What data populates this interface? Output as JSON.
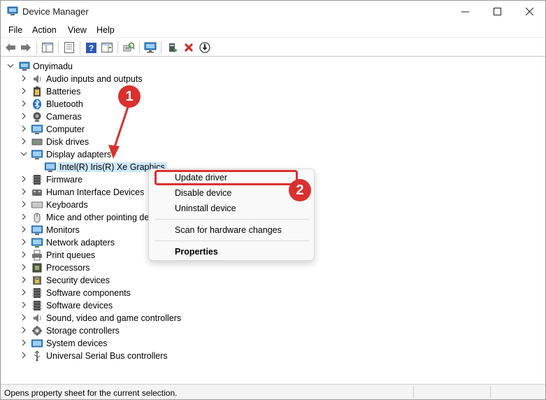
{
  "window": {
    "title": "Device Manager",
    "controls": {
      "minimize": "—",
      "maximize": "☐",
      "close": "✕"
    }
  },
  "menu": [
    "File",
    "Action",
    "View",
    "Help"
  ],
  "toolbar": {
    "icons": [
      "back-arrow-icon",
      "forward-arrow-icon",
      "show-hide-tree-icon",
      "properties-icon",
      "help-icon",
      "action-pane-icon",
      "scan-hardware-icon",
      "monitor-icon",
      "enable-device-icon",
      "uninstall-icon",
      "update-driver-icon"
    ]
  },
  "tree": {
    "root": "Onyimadu",
    "categories": [
      {
        "label": "Audio inputs and outputs",
        "icon": "speaker-icon",
        "expanded": false
      },
      {
        "label": "Batteries",
        "icon": "battery-icon",
        "expanded": false
      },
      {
        "label": "Bluetooth",
        "icon": "bluetooth-icon",
        "expanded": false
      },
      {
        "label": "Cameras",
        "icon": "camera-icon",
        "expanded": false
      },
      {
        "label": "Computer",
        "icon": "computer-icon",
        "expanded": false
      },
      {
        "label": "Disk drives",
        "icon": "disk-icon",
        "expanded": false
      },
      {
        "label": "Display adapters",
        "icon": "display-adapter-icon",
        "expanded": true
      },
      {
        "label": "Intel(R) Iris(R) Xe Graphics",
        "icon": "display-adapter-icon",
        "child": true,
        "selected": true
      },
      {
        "label": "Firmware",
        "icon": "firmware-icon",
        "expanded": false
      },
      {
        "label": "Human Interface Devices",
        "icon": "hid-icon",
        "expanded": false
      },
      {
        "label": "Keyboards",
        "icon": "keyboard-icon",
        "expanded": false
      },
      {
        "label": "Mice and other pointing de",
        "icon": "mouse-icon",
        "expanded": false
      },
      {
        "label": "Monitors",
        "icon": "monitor-icon",
        "expanded": false
      },
      {
        "label": "Network adapters",
        "icon": "network-icon",
        "expanded": false
      },
      {
        "label": "Print queues",
        "icon": "printer-icon",
        "expanded": false
      },
      {
        "label": "Processors",
        "icon": "processor-icon",
        "expanded": false
      },
      {
        "label": "Security devices",
        "icon": "security-icon",
        "expanded": false
      },
      {
        "label": "Software components",
        "icon": "software-component-icon",
        "expanded": false
      },
      {
        "label": "Software devices",
        "icon": "software-device-icon",
        "expanded": false
      },
      {
        "label": "Sound, video and game controllers",
        "icon": "sound-icon",
        "expanded": false
      },
      {
        "label": "Storage controllers",
        "icon": "storage-icon",
        "expanded": false
      },
      {
        "label": "System devices",
        "icon": "system-icon",
        "expanded": false
      },
      {
        "label": "Universal Serial Bus controllers",
        "icon": "usb-icon",
        "expanded": false
      }
    ]
  },
  "context_menu": {
    "update": "Update driver",
    "disable": "Disable device",
    "uninstall": "Uninstall device",
    "scan": "Scan for hardware changes",
    "properties": "Properties"
  },
  "annotations": {
    "step1": "1",
    "step2": "2",
    "color": "#d9312e"
  },
  "status": {
    "text": "Opens property sheet for the current selection."
  }
}
